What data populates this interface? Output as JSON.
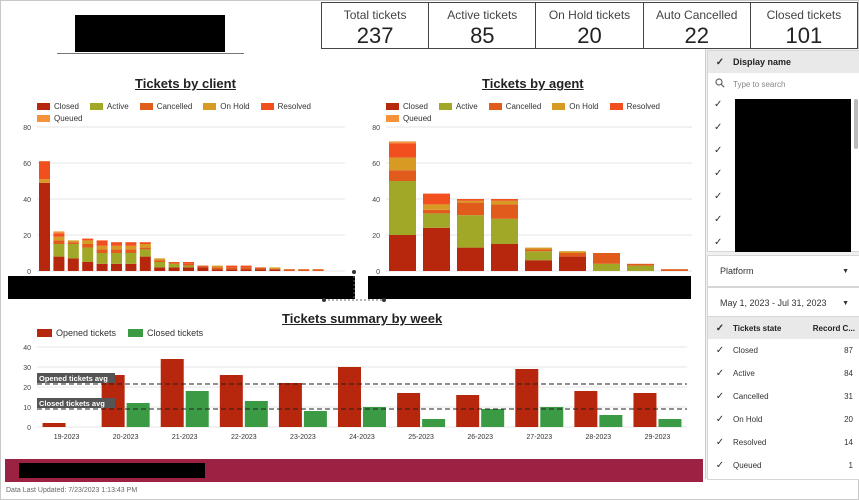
{
  "kpis": [
    {
      "label": "Total tickets",
      "value": "237"
    },
    {
      "label": "Active tickets",
      "value": "85"
    },
    {
      "label": "On Hold tickets",
      "value": "20"
    },
    {
      "label": "Auto Cancelled",
      "value": "22"
    },
    {
      "label": "Closed tickets",
      "value": "101"
    }
  ],
  "legend_status": [
    "Closed",
    "Active",
    "Cancelled",
    "On Hold",
    "Resolved",
    "Queued"
  ],
  "colors": {
    "Closed": "#b7270e",
    "Active": "#a1a828",
    "Cancelled": "#e05b1c",
    "On Hold": "#d79a23",
    "Resolved": "#f24f1e",
    "Queued": "#f5923a",
    "opened_bar": "#b7270e",
    "closed_bar": "#3a9b44",
    "footer": "#9b2242"
  },
  "sidebar": {
    "display_name_header": "Display name",
    "search_placeholder": "Type to search",
    "platform_label": "Platform",
    "date_range": "May 1, 2023 - Jul 31, 2023",
    "state_header": "Tickets state",
    "record_header": "Record C...",
    "states": [
      {
        "name": "Closed",
        "count": "87"
      },
      {
        "name": "Active",
        "count": "84"
      },
      {
        "name": "Cancelled",
        "count": "31"
      },
      {
        "name": "On Hold",
        "count": "20"
      },
      {
        "name": "Resolved",
        "count": "14"
      },
      {
        "name": "Queued",
        "count": "1"
      }
    ]
  },
  "footer": {
    "updated": "Data Last Updated: 7/23/2023 1:13:43 PM"
  },
  "chart_data": [
    {
      "type": "bar",
      "stacked": true,
      "title": "Tickets by client",
      "ylim": [
        0,
        80
      ],
      "yticks": [
        0,
        20,
        40,
        60,
        80
      ],
      "categories_redacted": true,
      "series": [
        {
          "name": "Closed",
          "values": [
            49,
            8,
            7,
            5,
            4,
            4,
            4,
            8,
            2,
            2,
            2,
            2,
            1,
            1,
            1,
            1,
            1,
            0,
            0,
            0
          ]
        },
        {
          "name": "Active",
          "values": [
            0,
            7,
            8,
            8,
            6,
            6,
            6,
            4,
            3,
            2,
            1,
            0,
            0,
            0,
            0,
            0,
            0,
            0,
            0,
            0
          ]
        },
        {
          "name": "Cancelled",
          "values": [
            0,
            2,
            1,
            2,
            2,
            2,
            2,
            1,
            1,
            1,
            1,
            1,
            1,
            1,
            1,
            1,
            0,
            1,
            1,
            1
          ]
        },
        {
          "name": "On Hold",
          "values": [
            2,
            2,
            1,
            2,
            2,
            2,
            2,
            2,
            1,
            0,
            0,
            0,
            1,
            0,
            0,
            0,
            1,
            0,
            0,
            0
          ]
        },
        {
          "name": "Resolved",
          "values": [
            10,
            2,
            0,
            1,
            3,
            2,
            2,
            1,
            0,
            0,
            1,
            0,
            0,
            1,
            1,
            0,
            0,
            0,
            0,
            0
          ]
        },
        {
          "name": "Queued",
          "values": [
            0,
            1,
            0,
            0,
            0,
            0,
            0,
            0,
            0,
            0,
            0,
            0,
            0,
            0,
            0,
            0,
            0,
            0,
            0,
            0
          ]
        }
      ]
    },
    {
      "type": "bar",
      "stacked": true,
      "title": "Tickets by agent",
      "ylim": [
        0,
        80
      ],
      "yticks": [
        0,
        20,
        40,
        60,
        80
      ],
      "categories_redacted": true,
      "series": [
        {
          "name": "Closed",
          "values": [
            20,
            24,
            13,
            15,
            6,
            8,
            0,
            0,
            0
          ]
        },
        {
          "name": "Active",
          "values": [
            30,
            8,
            18,
            14,
            5,
            0,
            4,
            3,
            0
          ]
        },
        {
          "name": "Cancelled",
          "values": [
            6,
            2,
            7,
            8,
            1,
            2,
            6,
            1,
            1
          ]
        },
        {
          "name": "On Hold",
          "values": [
            7,
            3,
            1,
            2,
            1,
            1,
            0,
            0,
            0
          ]
        },
        {
          "name": "Resolved",
          "values": [
            8,
            6,
            1,
            1,
            0,
            0,
            0,
            0,
            0
          ]
        },
        {
          "name": "Queued",
          "values": [
            1,
            0,
            0,
            0,
            0,
            0,
            0,
            0,
            0
          ]
        }
      ]
    },
    {
      "type": "bar",
      "title": "Tickets summary by week",
      "ylim": [
        0,
        40
      ],
      "yticks": [
        0,
        10,
        20,
        30,
        40
      ],
      "categories": [
        "19-2023",
        "20-2023",
        "21-2023",
        "22-2023",
        "23-2023",
        "24-2023",
        "25-2023",
        "26-2023",
        "27-2023",
        "28-2023",
        "29-2023"
      ],
      "series": [
        {
          "name": "Opened tickets",
          "values": [
            2,
            26,
            34,
            26,
            22,
            30,
            17,
            16,
            29,
            18,
            17
          ]
        },
        {
          "name": "Closed tickets",
          "values": [
            0,
            12,
            18,
            13,
            8,
            10,
            4,
            9,
            10,
            6,
            4
          ]
        }
      ],
      "reference_lines": [
        {
          "name": "Opened tickets avg",
          "value": 21.5
        },
        {
          "name": "Closed tickets avg",
          "value": 9
        }
      ]
    }
  ]
}
